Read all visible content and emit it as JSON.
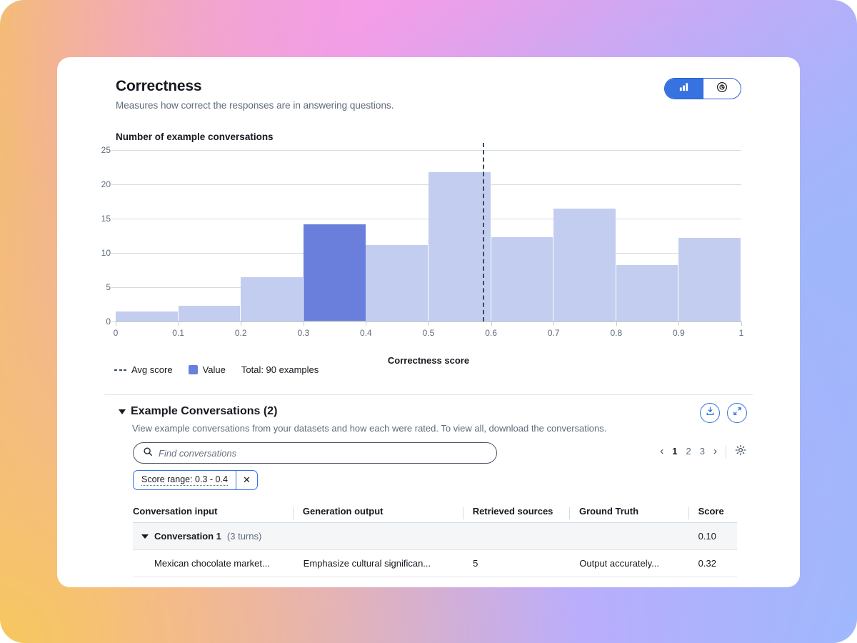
{
  "header": {
    "title": "Correctness",
    "subtitle": "Measures how correct the responses are in answering questions.",
    "view_toggle": {
      "bar_icon": "bar-chart-icon",
      "donut_icon": "donut-chart-icon",
      "active": "bar"
    }
  },
  "chart_data": {
    "type": "bar",
    "title": "Number of example conversations",
    "xlabel": "Correctness score",
    "ylabel": "Number of example conversations",
    "categories": [
      "0 - 0.1",
      "0.1 - 0.2",
      "0.2 - 0.3",
      "0.3 - 0.4",
      "0.4 - 0.5",
      "0.5 - 0.6",
      "0.6 - 0.7",
      "0.7 - 0.8",
      "0.8 - 0.9",
      "0.9 - 1"
    ],
    "bin_edges": [
      0,
      0.1,
      0.2,
      0.3,
      0.4,
      0.5,
      0.6,
      0.7,
      0.8,
      0.9,
      1
    ],
    "values": [
      1.5,
      2.3,
      6.5,
      14.2,
      11.1,
      21.8,
      12.3,
      16.5,
      8.2,
      12.2
    ],
    "selected_bin_index": 3,
    "xlim": [
      0,
      1
    ],
    "ylim": [
      0,
      25
    ],
    "xticks": [
      "0",
      "0.1",
      "0.2",
      "0.3",
      "0.4",
      "0.5",
      "0.6",
      "0.7",
      "0.8",
      "0.9",
      "1"
    ],
    "yticks": [
      0,
      5,
      10,
      15,
      20,
      25
    ],
    "grid": true,
    "avg_score_line": 0.587,
    "colors": {
      "bar": "#c3cdf0",
      "bar_selected": "#697fdb",
      "avg_line": "#3f4a5a",
      "accent": "#3672e0"
    },
    "legend": {
      "position": "bottom-left",
      "entries": [
        {
          "label": "Avg score",
          "marker": "dashed-line"
        },
        {
          "label": "Value",
          "marker": "square"
        }
      ],
      "total": "Total: 90 examples"
    }
  },
  "examples": {
    "title": "Example Conversations (2)",
    "description": "View example conversations from your datasets and how each were rated. To view all, download the conversations.",
    "download_icon": "download-icon",
    "expand_icon": "expand-icon",
    "search": {
      "placeholder": "Find conversations",
      "value": "",
      "icon": "search-icon"
    },
    "pagination": {
      "prev_icon": "chevron-left-icon",
      "next_icon": "chevron-right-icon",
      "pages": [
        "1",
        "2",
        "3"
      ],
      "current": "1",
      "settings_icon": "gear-icon"
    },
    "filter_chip": {
      "label": "Score range: 0.3 - 0.4",
      "remove_icon": "close-icon"
    },
    "columns": [
      "Conversation input",
      "Generation output",
      "Retrieved sources",
      "Ground Truth",
      "Score"
    ],
    "rows": [
      {
        "type": "group",
        "name": "Conversation 1",
        "turns": "(3 turns)",
        "score": "0.10"
      },
      {
        "type": "turn",
        "conversation_input": "Mexican chocolate market...",
        "generation_output": "Emphasize cultural significan...",
        "retrieved_sources": "5",
        "ground_truth": "Output accurately...",
        "score": "0.32"
      }
    ]
  }
}
